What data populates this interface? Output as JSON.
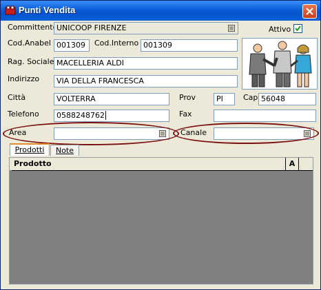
{
  "window": {
    "title": "Punti Vendita"
  },
  "form": {
    "committente": {
      "label": "Committente",
      "value": "UNICOOP FIRENZE"
    },
    "attivo": {
      "label": "Attivo",
      "checked": true
    },
    "cod_anabel": {
      "label": "Cod.Anabel",
      "value": "001309"
    },
    "cod_interno": {
      "label": "Cod.Interno",
      "value": "001309"
    },
    "rag_sociale": {
      "label": "Rag. Sociale",
      "value": "MACELLERIA ALDI"
    },
    "indirizzo": {
      "label": "Indirizzo",
      "value": "VIA DELLA FRANCESCA"
    },
    "citta": {
      "label": "Città",
      "value": "VOLTERRA"
    },
    "prov": {
      "label": "Prov",
      "value": "PI"
    },
    "cap": {
      "label": "Cap",
      "value": "56048"
    },
    "telefono": {
      "label": "Telefono",
      "value": "0588248762"
    },
    "fax": {
      "label": "Fax",
      "value": ""
    },
    "area": {
      "label": "Area",
      "value": ""
    },
    "canale": {
      "label": "Canale",
      "value": ""
    }
  },
  "tabs": [
    {
      "label": "Prodotti",
      "active": true
    },
    {
      "label": "Note",
      "active": false
    }
  ],
  "grid": {
    "columns": [
      "Prodotto",
      "A"
    ]
  },
  "icons": {
    "app": "app-icon",
    "close": "close-icon",
    "lookup": "list-lookup-icon",
    "photo": "business-handshake-picture"
  },
  "colors": {
    "titlebar": "#0a5fd8",
    "annotation": "#7a1010"
  }
}
